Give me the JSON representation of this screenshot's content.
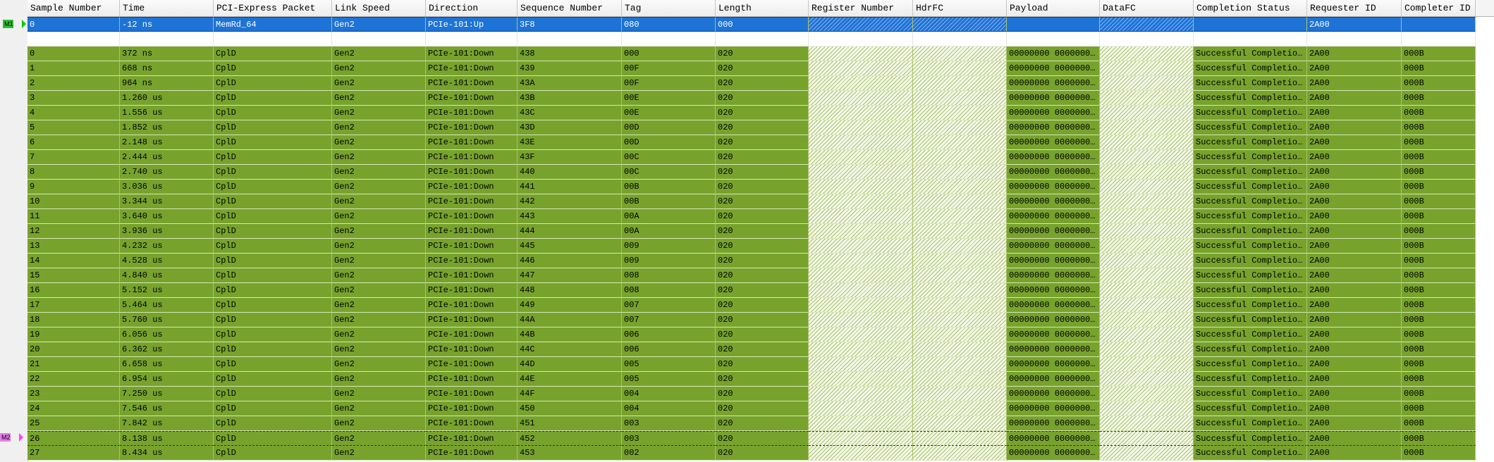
{
  "columns": [
    "Sample Number",
    "Time",
    "PCI-Express Packet",
    "Link Speed",
    "Direction",
    "Sequence Number",
    "Tag",
    "Length",
    "Register Number",
    "HdrFC",
    "Payload",
    "DataFC",
    "Completion Status",
    "Requester ID",
    "Completer ID"
  ],
  "markers": [
    {
      "label": "M1",
      "color": "#2fbe2f",
      "arrow": "#00d000"
    },
    {
      "label": "M2",
      "color": "#e67ce6",
      "arrow": "#ff40ff"
    }
  ],
  "selected_row": [
    "0",
    "-12 ns",
    "MemRd_64",
    "Gen2",
    "PCIe-101:Up",
    "3F8",
    "080",
    "000",
    "",
    "",
    "",
    "",
    "",
    "2A00",
    ""
  ],
  "rows": [
    [
      "0",
      "372 ns",
      "CplD",
      "Gen2",
      "PCIe-101:Down",
      "438",
      "000",
      "020",
      "",
      "",
      "00000000 0000000…",
      "",
      "Successful Completio…",
      "2A00",
      "000B"
    ],
    [
      "1",
      "668 ns",
      "CplD",
      "Gen2",
      "PCIe-101:Down",
      "439",
      "00F",
      "020",
      "",
      "",
      "00000000 0000000…",
      "",
      "Successful Completio…",
      "2A00",
      "000B"
    ],
    [
      "2",
      "964 ns",
      "CplD",
      "Gen2",
      "PCIe-101:Down",
      "43A",
      "00F",
      "020",
      "",
      "",
      "00000000 0000000…",
      "",
      "Successful Completio…",
      "2A00",
      "000B"
    ],
    [
      "3",
      "1.260 us",
      "CplD",
      "Gen2",
      "PCIe-101:Down",
      "43B",
      "00E",
      "020",
      "",
      "",
      "00000000 0000000…",
      "",
      "Successful Completio…",
      "2A00",
      "000B"
    ],
    [
      "4",
      "1.556 us",
      "CplD",
      "Gen2",
      "PCIe-101:Down",
      "43C",
      "00E",
      "020",
      "",
      "",
      "00000000 0000000…",
      "",
      "Successful Completio…",
      "2A00",
      "000B"
    ],
    [
      "5",
      "1.852 us",
      "CplD",
      "Gen2",
      "PCIe-101:Down",
      "43D",
      "00D",
      "020",
      "",
      "",
      "00000000 0000000…",
      "",
      "Successful Completio…",
      "2A00",
      "000B"
    ],
    [
      "6",
      "2.148 us",
      "CplD",
      "Gen2",
      "PCIe-101:Down",
      "43E",
      "00D",
      "020",
      "",
      "",
      "00000000 0000000…",
      "",
      "Successful Completio…",
      "2A00",
      "000B"
    ],
    [
      "7",
      "2.444 us",
      "CplD",
      "Gen2",
      "PCIe-101:Down",
      "43F",
      "00C",
      "020",
      "",
      "",
      "00000000 0000000…",
      "",
      "Successful Completio…",
      "2A00",
      "000B"
    ],
    [
      "8",
      "2.740 us",
      "CplD",
      "Gen2",
      "PCIe-101:Down",
      "440",
      "00C",
      "020",
      "",
      "",
      "00000000 0000000…",
      "",
      "Successful Completio…",
      "2A00",
      "000B"
    ],
    [
      "9",
      "3.036 us",
      "CplD",
      "Gen2",
      "PCIe-101:Down",
      "441",
      "00B",
      "020",
      "",
      "",
      "00000000 0000000…",
      "",
      "Successful Completio…",
      "2A00",
      "000B"
    ],
    [
      "10",
      "3.344 us",
      "CplD",
      "Gen2",
      "PCIe-101:Down",
      "442",
      "00B",
      "020",
      "",
      "",
      "00000000 0000000…",
      "",
      "Successful Completio…",
      "2A00",
      "000B"
    ],
    [
      "11",
      "3.640 us",
      "CplD",
      "Gen2",
      "PCIe-101:Down",
      "443",
      "00A",
      "020",
      "",
      "",
      "00000000 0000000…",
      "",
      "Successful Completio…",
      "2A00",
      "000B"
    ],
    [
      "12",
      "3.936 us",
      "CplD",
      "Gen2",
      "PCIe-101:Down",
      "444",
      "00A",
      "020",
      "",
      "",
      "00000000 0000000…",
      "",
      "Successful Completio…",
      "2A00",
      "000B"
    ],
    [
      "13",
      "4.232 us",
      "CplD",
      "Gen2",
      "PCIe-101:Down",
      "445",
      "009",
      "020",
      "",
      "",
      "00000000 0000000…",
      "",
      "Successful Completio…",
      "2A00",
      "000B"
    ],
    [
      "14",
      "4.528 us",
      "CplD",
      "Gen2",
      "PCIe-101:Down",
      "446",
      "009",
      "020",
      "",
      "",
      "00000000 0000000…",
      "",
      "Successful Completio…",
      "2A00",
      "000B"
    ],
    [
      "15",
      "4.840 us",
      "CplD",
      "Gen2",
      "PCIe-101:Down",
      "447",
      "008",
      "020",
      "",
      "",
      "00000000 0000000…",
      "",
      "Successful Completio…",
      "2A00",
      "000B"
    ],
    [
      "16",
      "5.152 us",
      "CplD",
      "Gen2",
      "PCIe-101:Down",
      "448",
      "008",
      "020",
      "",
      "",
      "00000000 0000000…",
      "",
      "Successful Completio…",
      "2A00",
      "000B"
    ],
    [
      "17",
      "5.464 us",
      "CplD",
      "Gen2",
      "PCIe-101:Down",
      "449",
      "007",
      "020",
      "",
      "",
      "00000000 0000000…",
      "",
      "Successful Completio…",
      "2A00",
      "000B"
    ],
    [
      "18",
      "5.760 us",
      "CplD",
      "Gen2",
      "PCIe-101:Down",
      "44A",
      "007",
      "020",
      "",
      "",
      "00000000 0000000…",
      "",
      "Successful Completio…",
      "2A00",
      "000B"
    ],
    [
      "19",
      "6.056 us",
      "CplD",
      "Gen2",
      "PCIe-101:Down",
      "44B",
      "006",
      "020",
      "",
      "",
      "00000000 0000000…",
      "",
      "Successful Completio…",
      "2A00",
      "000B"
    ],
    [
      "20",
      "6.362 us",
      "CplD",
      "Gen2",
      "PCIe-101:Down",
      "44C",
      "006",
      "020",
      "",
      "",
      "00000000 0000000…",
      "",
      "Successful Completio…",
      "2A00",
      "000B"
    ],
    [
      "21",
      "6.658 us",
      "CplD",
      "Gen2",
      "PCIe-101:Down",
      "44D",
      "005",
      "020",
      "",
      "",
      "00000000 0000000…",
      "",
      "Successful Completio…",
      "2A00",
      "000B"
    ],
    [
      "22",
      "6.954 us",
      "CplD",
      "Gen2",
      "PCIe-101:Down",
      "44E",
      "005",
      "020",
      "",
      "",
      "00000000 0000000…",
      "",
      "Successful Completio…",
      "2A00",
      "000B"
    ],
    [
      "23",
      "7.250 us",
      "CplD",
      "Gen2",
      "PCIe-101:Down",
      "44F",
      "004",
      "020",
      "",
      "",
      "00000000 0000000…",
      "",
      "Successful Completio…",
      "2A00",
      "000B"
    ],
    [
      "24",
      "7.546 us",
      "CplD",
      "Gen2",
      "PCIe-101:Down",
      "450",
      "004",
      "020",
      "",
      "",
      "00000000 0000000…",
      "",
      "Successful Completio…",
      "2A00",
      "000B"
    ],
    [
      "25",
      "7.842 us",
      "CplD",
      "Gen2",
      "PCIe-101:Down",
      "451",
      "003",
      "020",
      "",
      "",
      "00000000 0000000…",
      "",
      "Successful Completio…",
      "2A00",
      "000B"
    ],
    [
      "26",
      "8.138 us",
      "CplD",
      "Gen2",
      "PCIe-101:Down",
      "452",
      "003",
      "020",
      "",
      "",
      "00000000 0000000…",
      "",
      "Successful Completio…",
      "2A00",
      "000B"
    ],
    [
      "27",
      "8.434 us",
      "CplD",
      "Gen2",
      "PCIe-101:Down",
      "453",
      "002",
      "020",
      "",
      "",
      "00000000 0000000…",
      "",
      "Successful Completio…",
      "2A00",
      "000B"
    ]
  ],
  "colors": {
    "row_green": "#77a32d",
    "selection_blue": "#1e73d6"
  }
}
